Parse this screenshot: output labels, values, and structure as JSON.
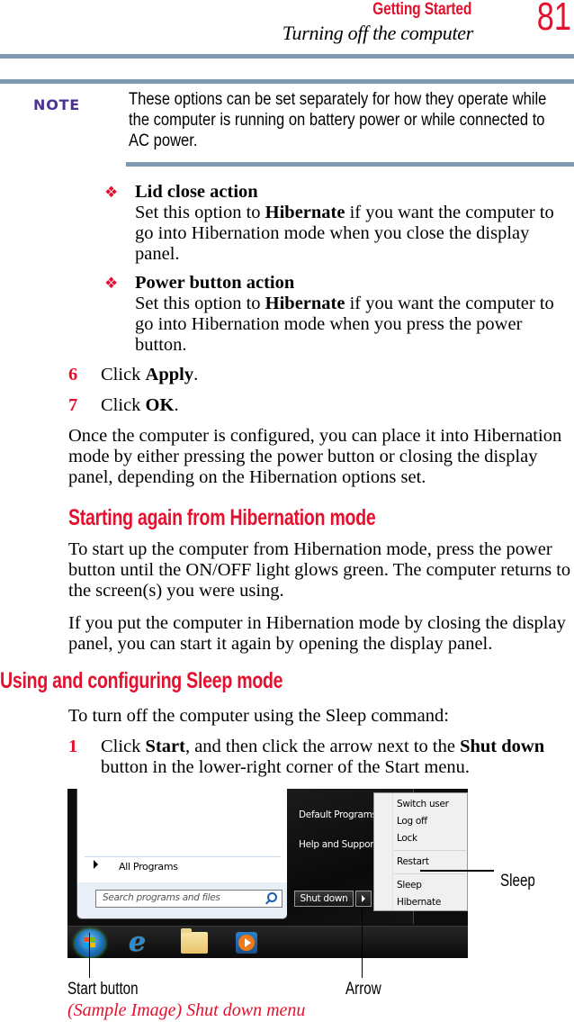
{
  "header": {
    "section": "Getting Started",
    "title": "Turning off the computer",
    "page_number": "81"
  },
  "note": {
    "label": "NOTE",
    "text": "These options can be set separately for how they operate while the computer is running on battery power or while connected to AC power."
  },
  "bullets": [
    {
      "title": "Lid close action",
      "pre": "Set this option to ",
      "bold": "Hibernate",
      "post": " if you want the computer to go into Hibernation mode when you close the display panel."
    },
    {
      "title": "Power button action",
      "pre": "Set this option to ",
      "bold": "Hibernate",
      "post": " if you want the computer to go into Hibernation mode when you press the power button."
    }
  ],
  "steps_a": [
    {
      "num": "6",
      "pre": "Click ",
      "bold": "Apply",
      "post": "."
    },
    {
      "num": "7",
      "pre": "Click ",
      "bold": "OK",
      "post": "."
    }
  ],
  "para_configured": "Once the computer is configured, you can place it into Hibernation mode by either pressing the power button or closing the display panel, depending on the Hibernation options set.",
  "section_start_again": {
    "heading": "Starting again from Hibernation mode",
    "para1": "To start up the computer from Hibernation mode, press the power button until the ON/OFF light glows green. The computer returns to the screen(s) you were using.",
    "para2": "If you put the computer in Hibernation mode by closing the display panel, you can start it again by opening the display panel."
  },
  "section_sleep": {
    "heading": "Using and configuring Sleep mode",
    "intro": "To turn off the computer using the Sleep command:",
    "step": {
      "num": "1",
      "pre": "Click ",
      "bold1": "Start",
      "mid": ", and then click the arrow next to the ",
      "bold2": "Shut down",
      "post": " button in the lower-right corner of the Start menu."
    }
  },
  "screenshot": {
    "all_programs": "All Programs",
    "search_placeholder": "Search programs and files",
    "right_pane": [
      "Default Programs",
      "Help and Support"
    ],
    "shutdown_label": "Shut down",
    "popup_items": [
      "Switch user",
      "Log off",
      "Lock",
      "Restart",
      "Sleep",
      "Hibernate"
    ]
  },
  "callouts": {
    "sleep": "Sleep",
    "start_button": "Start button",
    "arrow": "Arrow"
  },
  "caption": "(Sample Image) Shut down menu"
}
